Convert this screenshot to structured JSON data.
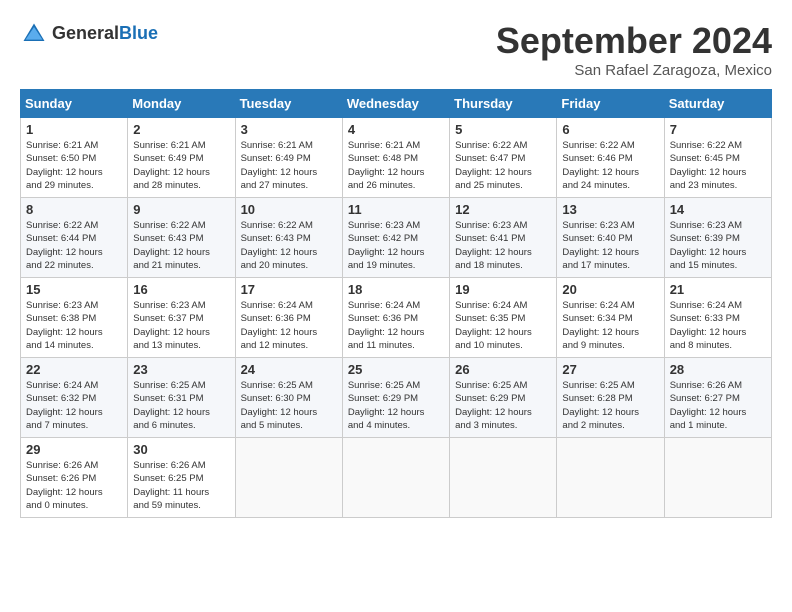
{
  "header": {
    "logo_general": "General",
    "logo_blue": "Blue",
    "title": "September 2024",
    "subtitle": "San Rafael Zaragoza, Mexico"
  },
  "days_of_week": [
    "Sunday",
    "Monday",
    "Tuesday",
    "Wednesday",
    "Thursday",
    "Friday",
    "Saturday"
  ],
  "weeks": [
    [
      {
        "day": "1",
        "sunrise": "6:21 AM",
        "sunset": "6:50 PM",
        "daylight": "12 hours and 29 minutes."
      },
      {
        "day": "2",
        "sunrise": "6:21 AM",
        "sunset": "6:49 PM",
        "daylight": "12 hours and 28 minutes."
      },
      {
        "day": "3",
        "sunrise": "6:21 AM",
        "sunset": "6:49 PM",
        "daylight": "12 hours and 27 minutes."
      },
      {
        "day": "4",
        "sunrise": "6:21 AM",
        "sunset": "6:48 PM",
        "daylight": "12 hours and 26 minutes."
      },
      {
        "day": "5",
        "sunrise": "6:22 AM",
        "sunset": "6:47 PM",
        "daylight": "12 hours and 25 minutes."
      },
      {
        "day": "6",
        "sunrise": "6:22 AM",
        "sunset": "6:46 PM",
        "daylight": "12 hours and 24 minutes."
      },
      {
        "day": "7",
        "sunrise": "6:22 AM",
        "sunset": "6:45 PM",
        "daylight": "12 hours and 23 minutes."
      }
    ],
    [
      {
        "day": "8",
        "sunrise": "6:22 AM",
        "sunset": "6:44 PM",
        "daylight": "12 hours and 22 minutes."
      },
      {
        "day": "9",
        "sunrise": "6:22 AM",
        "sunset": "6:43 PM",
        "daylight": "12 hours and 21 minutes."
      },
      {
        "day": "10",
        "sunrise": "6:22 AM",
        "sunset": "6:43 PM",
        "daylight": "12 hours and 20 minutes."
      },
      {
        "day": "11",
        "sunrise": "6:23 AM",
        "sunset": "6:42 PM",
        "daylight": "12 hours and 19 minutes."
      },
      {
        "day": "12",
        "sunrise": "6:23 AM",
        "sunset": "6:41 PM",
        "daylight": "12 hours and 18 minutes."
      },
      {
        "day": "13",
        "sunrise": "6:23 AM",
        "sunset": "6:40 PM",
        "daylight": "12 hours and 17 minutes."
      },
      {
        "day": "14",
        "sunrise": "6:23 AM",
        "sunset": "6:39 PM",
        "daylight": "12 hours and 15 minutes."
      }
    ],
    [
      {
        "day": "15",
        "sunrise": "6:23 AM",
        "sunset": "6:38 PM",
        "daylight": "12 hours and 14 minutes."
      },
      {
        "day": "16",
        "sunrise": "6:23 AM",
        "sunset": "6:37 PM",
        "daylight": "12 hours and 13 minutes."
      },
      {
        "day": "17",
        "sunrise": "6:24 AM",
        "sunset": "6:36 PM",
        "daylight": "12 hours and 12 minutes."
      },
      {
        "day": "18",
        "sunrise": "6:24 AM",
        "sunset": "6:36 PM",
        "daylight": "12 hours and 11 minutes."
      },
      {
        "day": "19",
        "sunrise": "6:24 AM",
        "sunset": "6:35 PM",
        "daylight": "12 hours and 10 minutes."
      },
      {
        "day": "20",
        "sunrise": "6:24 AM",
        "sunset": "6:34 PM",
        "daylight": "12 hours and 9 minutes."
      },
      {
        "day": "21",
        "sunrise": "6:24 AM",
        "sunset": "6:33 PM",
        "daylight": "12 hours and 8 minutes."
      }
    ],
    [
      {
        "day": "22",
        "sunrise": "6:24 AM",
        "sunset": "6:32 PM",
        "daylight": "12 hours and 7 minutes."
      },
      {
        "day": "23",
        "sunrise": "6:25 AM",
        "sunset": "6:31 PM",
        "daylight": "12 hours and 6 minutes."
      },
      {
        "day": "24",
        "sunrise": "6:25 AM",
        "sunset": "6:30 PM",
        "daylight": "12 hours and 5 minutes."
      },
      {
        "day": "25",
        "sunrise": "6:25 AM",
        "sunset": "6:29 PM",
        "daylight": "12 hours and 4 minutes."
      },
      {
        "day": "26",
        "sunrise": "6:25 AM",
        "sunset": "6:29 PM",
        "daylight": "12 hours and 3 minutes."
      },
      {
        "day": "27",
        "sunrise": "6:25 AM",
        "sunset": "6:28 PM",
        "daylight": "12 hours and 2 minutes."
      },
      {
        "day": "28",
        "sunrise": "6:26 AM",
        "sunset": "6:27 PM",
        "daylight": "12 hours and 1 minute."
      }
    ],
    [
      {
        "day": "29",
        "sunrise": "6:26 AM",
        "sunset": "6:26 PM",
        "daylight": "12 hours and 0 minutes."
      },
      {
        "day": "30",
        "sunrise": "6:26 AM",
        "sunset": "6:25 PM",
        "daylight": "11 hours and 59 minutes."
      },
      null,
      null,
      null,
      null,
      null
    ]
  ]
}
